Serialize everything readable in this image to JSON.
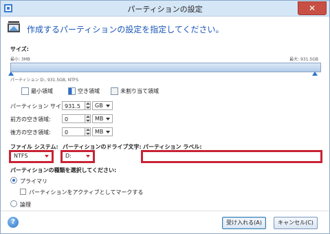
{
  "window": {
    "title": "パーティションの設定",
    "close_label": "✕"
  },
  "header": {
    "text": "作成するパーティションの設定を指定してください。"
  },
  "size_section": {
    "label": "サイズ:",
    "min_text": "最小: 3MB",
    "max_text": "最大: 931.5GB",
    "partition_info": "パーティション D:, 931.5GB, NTFS"
  },
  "legend": {
    "min_area": "最小領域",
    "free_area": "空き領域",
    "unallocated": "未割り当て領域"
  },
  "fields": {
    "partition_size": {
      "label": "パーティション サイズ:",
      "value": "931.5",
      "unit": "GB"
    },
    "free_before": {
      "label": "前方の空き領域:",
      "value": "0",
      "unit": "MB"
    },
    "free_after": {
      "label": "後方の空き領域:",
      "value": "0",
      "unit": "MB"
    }
  },
  "filesystem": {
    "label": "ファイル システム:",
    "value": "NTFS"
  },
  "drive_letter": {
    "label": "パーティションのドライブ文字:",
    "value": "D:"
  },
  "partition_label": {
    "label": "パーティション ラベル:",
    "value": ""
  },
  "partition_type": {
    "label": "パーティションの種類を選択してください:",
    "primary": "プライマリ",
    "mark_active": "パーティションをアクティブとしてマークする",
    "logical": "論理"
  },
  "buttons": {
    "help": "?",
    "accept": "受け入れる(A)",
    "cancel": "キャンセル(C)"
  },
  "colors": {
    "highlight": "#c82334",
    "accent": "#1a55b8"
  }
}
